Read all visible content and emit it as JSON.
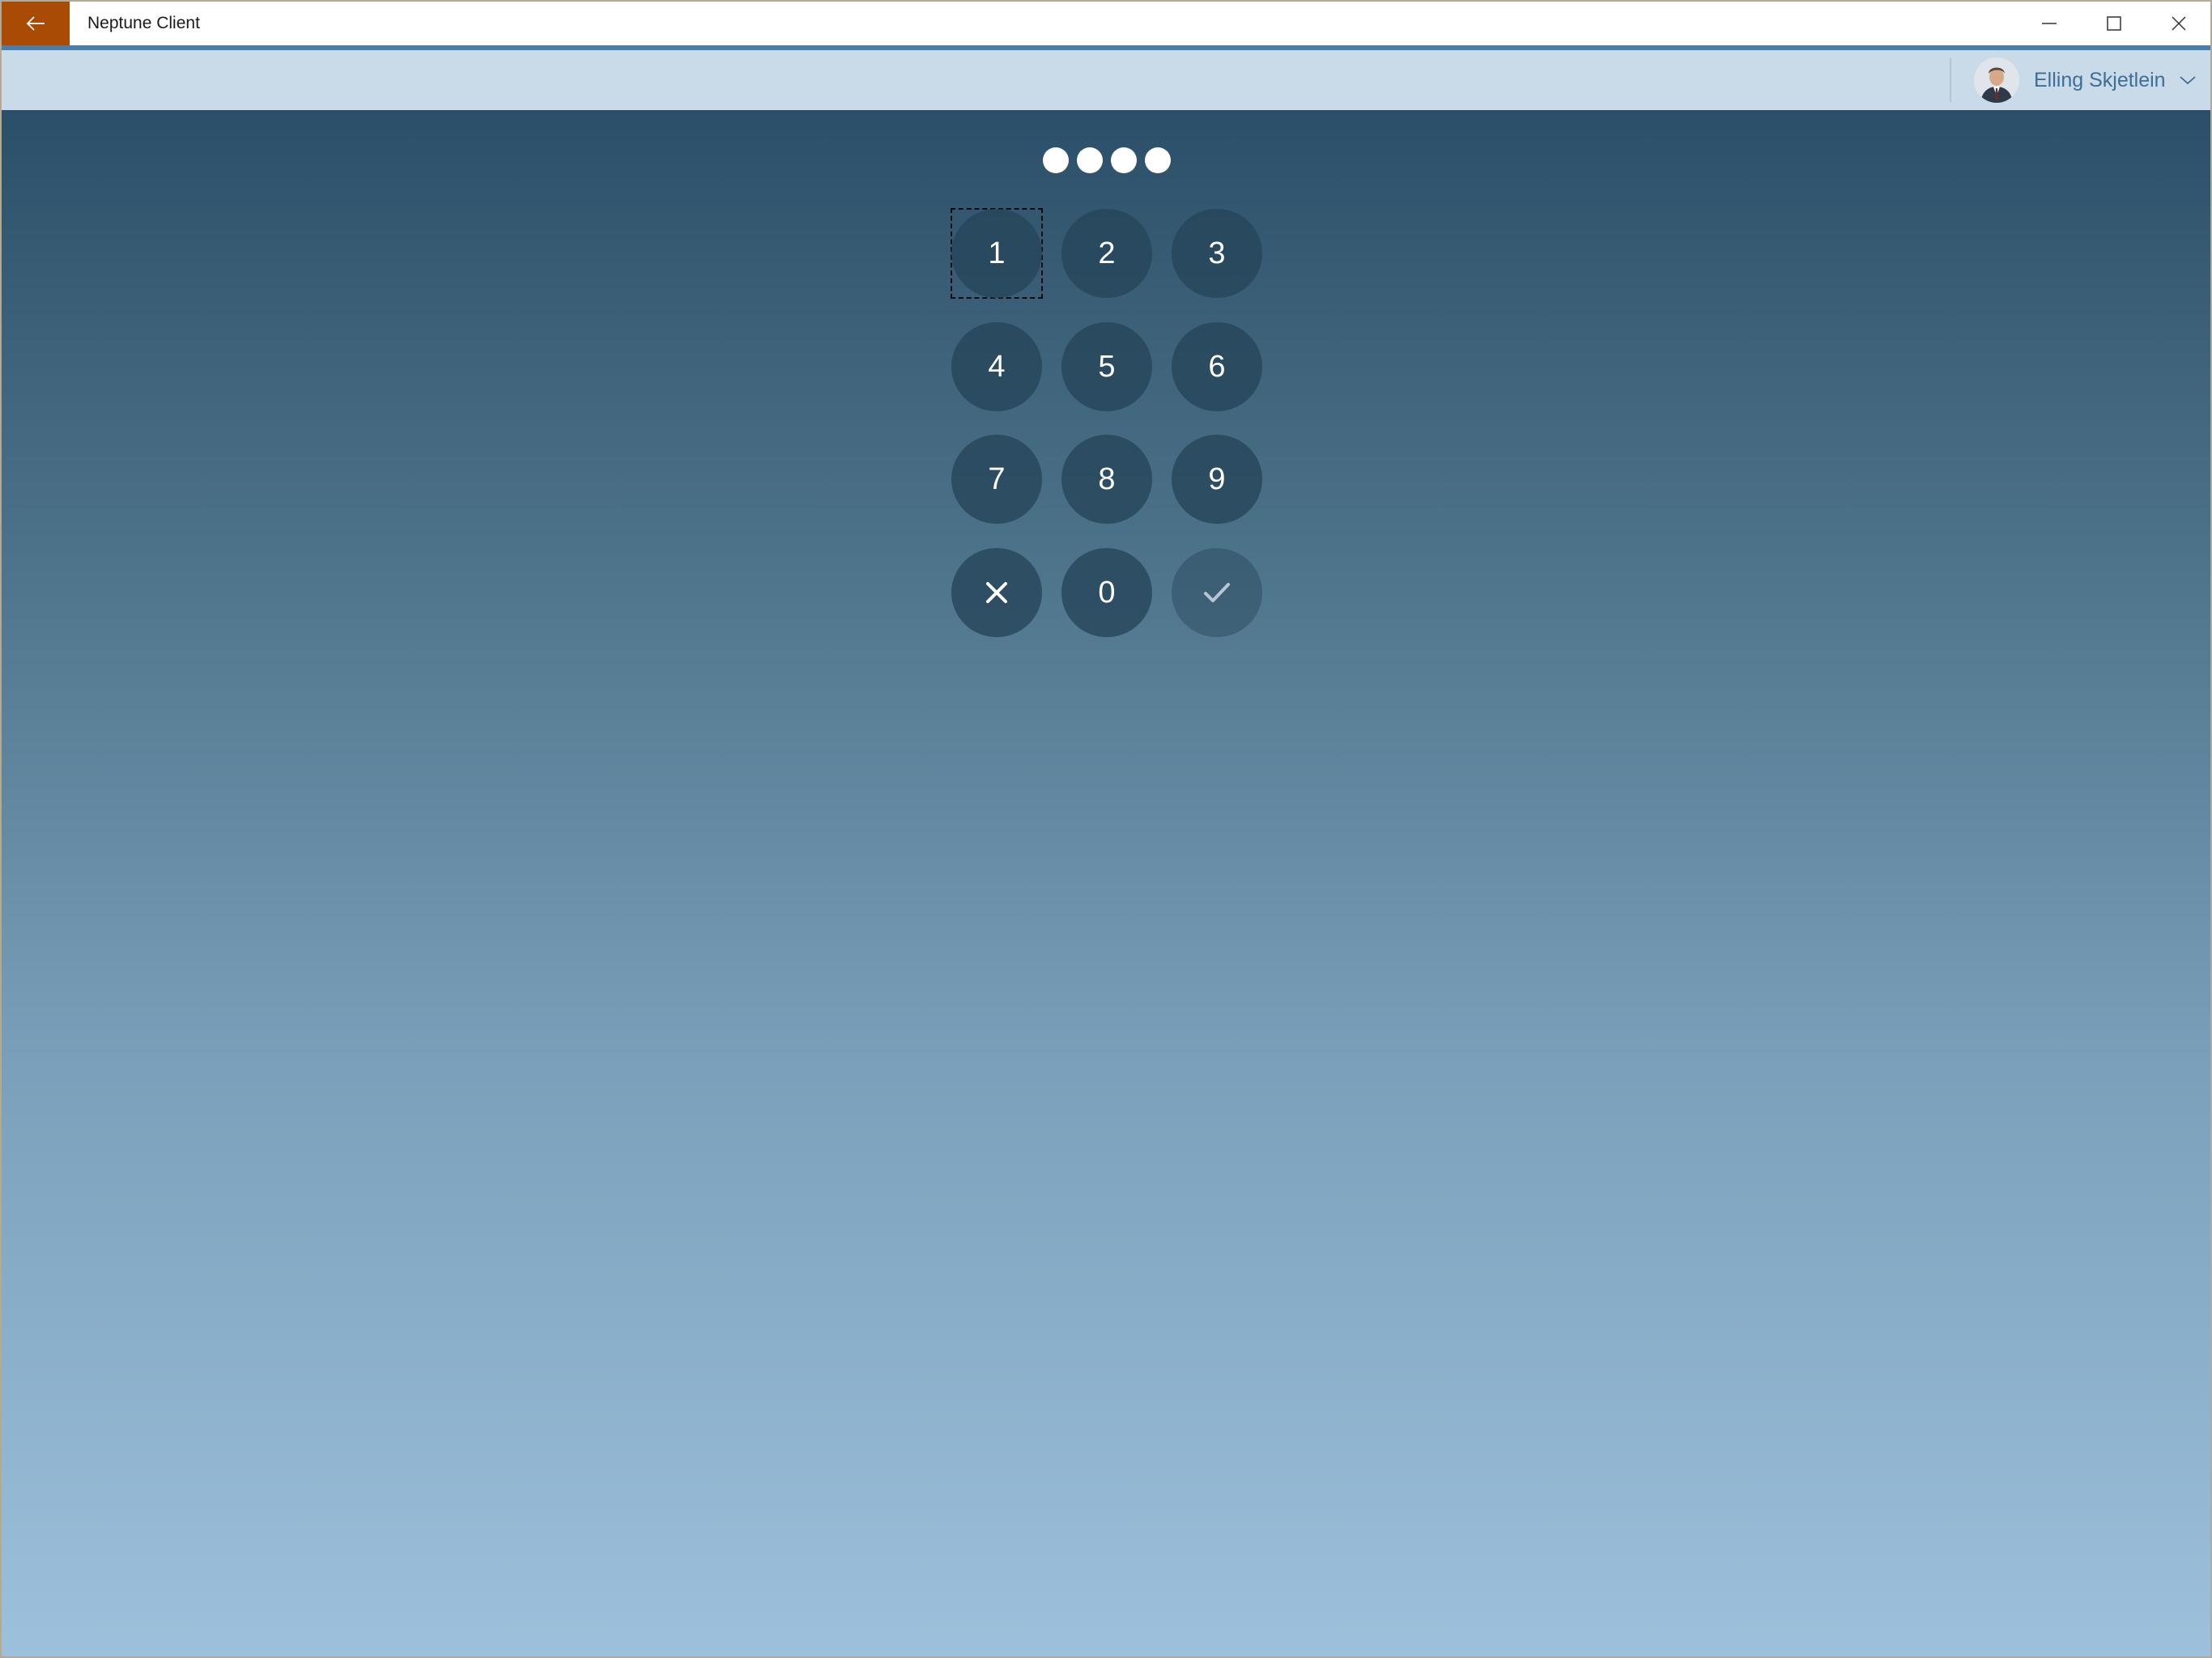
{
  "window": {
    "title": "Neptune Client",
    "back_icon": "arrow-left-icon",
    "controls": [
      "minimize-icon",
      "maximize-icon",
      "close-icon"
    ],
    "accent_color": "#a94a05"
  },
  "header": {
    "user_name": "Elling Skjetlein",
    "avatar_icon": "user-avatar",
    "dropdown_icon": "chevron-down-icon"
  },
  "pin": {
    "entered_count": 4,
    "dots": [
      "●",
      "●",
      "●",
      "●"
    ]
  },
  "keypad": {
    "keys": [
      {
        "label": "1"
      },
      {
        "label": "2"
      },
      {
        "label": "3"
      },
      {
        "label": "4"
      },
      {
        "label": "5"
      },
      {
        "label": "6"
      },
      {
        "label": "7"
      },
      {
        "label": "8"
      },
      {
        "label": "9"
      },
      {
        "label": "",
        "icon": "clear-x-icon"
      },
      {
        "label": "0"
      },
      {
        "label": "",
        "icon": "checkmark-icon"
      }
    ]
  }
}
